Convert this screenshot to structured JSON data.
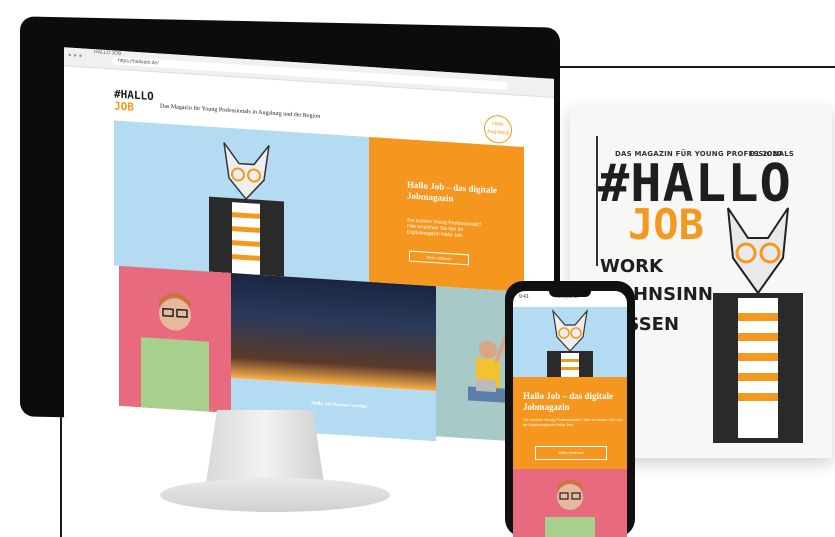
{
  "browser": {
    "tab_title": "HALLO JOB",
    "url": "https://hallojob.de/"
  },
  "site": {
    "logo_line1": "#HALLO",
    "logo_line2": "JOB",
    "tagline": "Das Magazin für Young Professionals in Augsburg und der Region",
    "stamp_text": "Hallo Augsburg"
  },
  "hero": {
    "title": "Hallo Job – das digitale Jobmagazin",
    "text": "Sie suchen Young Professionals? Hier erreichen Sie sie! Im Digitalmagazin Hallo Job.",
    "button_label": "Mehr erfahren"
  },
  "tiles": {
    "partner_text": "Hallo Job Partner werden"
  },
  "magazine": {
    "top_line": "DAS MAGAZIN FÜR YOUNG PROFESSIONALS",
    "issue": "01.2020",
    "title_line1": "#HALLO",
    "title_line2": "JOB",
    "word1": "WORK",
    "word2": "WAHNSINN",
    "word3": "WISSEN"
  },
  "phone": {
    "time": "9:41",
    "url": "hallojob.de",
    "title": "Hallo Job – das digitale Jobmagazin",
    "text": "Sie suchen Young Professionals? Hier erreichen Sie sie! Im Digitalmagazin Hallo Job.",
    "button_label": "Mehr erfahren"
  },
  "colors": {
    "orange": "#f5961e",
    "sky": "#b3dcf2",
    "pink": "#e86a7f",
    "dark": "#1e1e1e"
  }
}
